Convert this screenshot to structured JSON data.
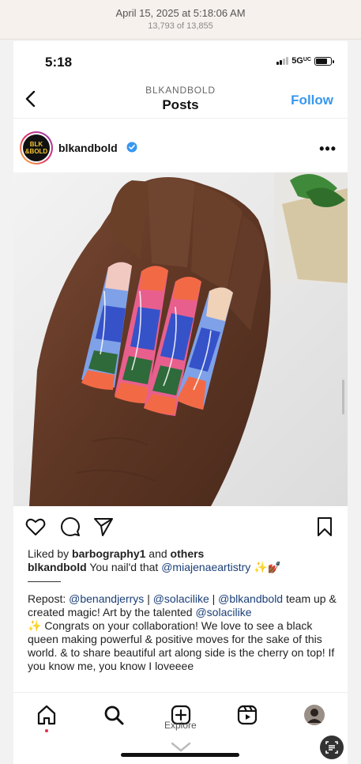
{
  "photos": {
    "date": "April 15, 2025 at 5:18:06 AM",
    "count": "13,793 of 13,855"
  },
  "status_bar": {
    "time": "5:18",
    "network": "5G",
    "network_suffix": "UC",
    "battery_level": 0.8
  },
  "nav": {
    "account": "BLKANDBOLD",
    "title": "Posts",
    "follow_label": "Follow"
  },
  "post": {
    "username": "blkandbold",
    "verified": true,
    "avatar_text": "BLK &BOLD",
    "likes": {
      "prefix": "Liked by",
      "user": "barbography1",
      "and": "and",
      "others": "others"
    },
    "caption": {
      "author": "blkandbold",
      "text": "You nail'd that",
      "mention": "@miajenaeartistry",
      "emoji": "✨💅🏾",
      "divider": "———",
      "repost_prefix": "Repost:",
      "repost_m1": "@benandjerrys",
      "sep1": "|",
      "repost_m2": "@solacilike",
      "sep2": "|",
      "repost_m3": "@blkandbold",
      "repost_line2": "team up & created magic! Art by the talented",
      "repost_m4": "@solacilike",
      "body": "✨ Congrats on your collaboration! We love to see a black queen making powerful & positive moves for the sake of this world. & to share beautiful art along side is the cherry on top! If you know me, you know I loveeee"
    }
  },
  "bottom_nav": {
    "tooltip": "Explore"
  },
  "icons": {
    "back": "chevron-left-icon",
    "more": "more-horizontal-icon",
    "like": "heart-icon",
    "comment": "comment-icon",
    "share": "send-icon",
    "save": "bookmark-icon",
    "home": "home-icon",
    "search": "search-icon",
    "create": "plus-square-icon",
    "reels": "reels-icon",
    "profile": "profile-avatar-icon",
    "live_text": "live-text-icon"
  },
  "colors": {
    "accent": "#3897f0",
    "mention": "#1b3f77",
    "verified": "#3897f0",
    "notify_dot": "#e3324b"
  }
}
